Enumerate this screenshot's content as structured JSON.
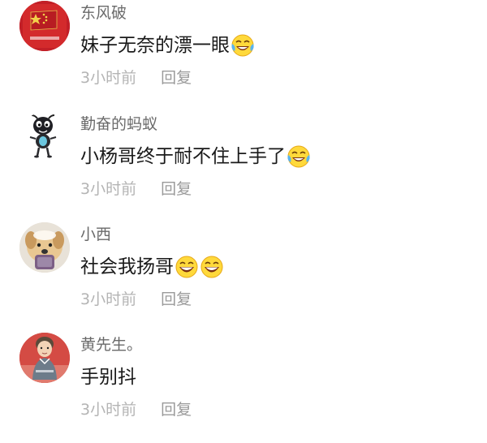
{
  "comments": [
    {
      "username": "东风破",
      "avatar": "flag-avatar",
      "text": "妹子无奈的漂一眼",
      "emojis": [
        "laughing-tears-emoji"
      ],
      "time": "3小时前",
      "reply_label": "回复"
    },
    {
      "username": "勤奋的蚂蚁",
      "avatar": "cartoon-ant-avatar",
      "text": "小杨哥终于耐不住上手了",
      "emojis": [
        "laughing-tears-emoji"
      ],
      "time": "3小时前",
      "reply_label": "回复"
    },
    {
      "username": "小西",
      "avatar": "dog-photo-avatar",
      "text": "社会我扬哥",
      "emojis": [
        "grinning-emoji",
        "grinning-emoji"
      ],
      "time": "3小时前",
      "reply_label": "回复"
    },
    {
      "username": "黄先生。",
      "avatar": "child-photo-avatar",
      "text": "手别抖",
      "emojis": [],
      "time": "3小时前",
      "reply_label": "回复"
    }
  ]
}
